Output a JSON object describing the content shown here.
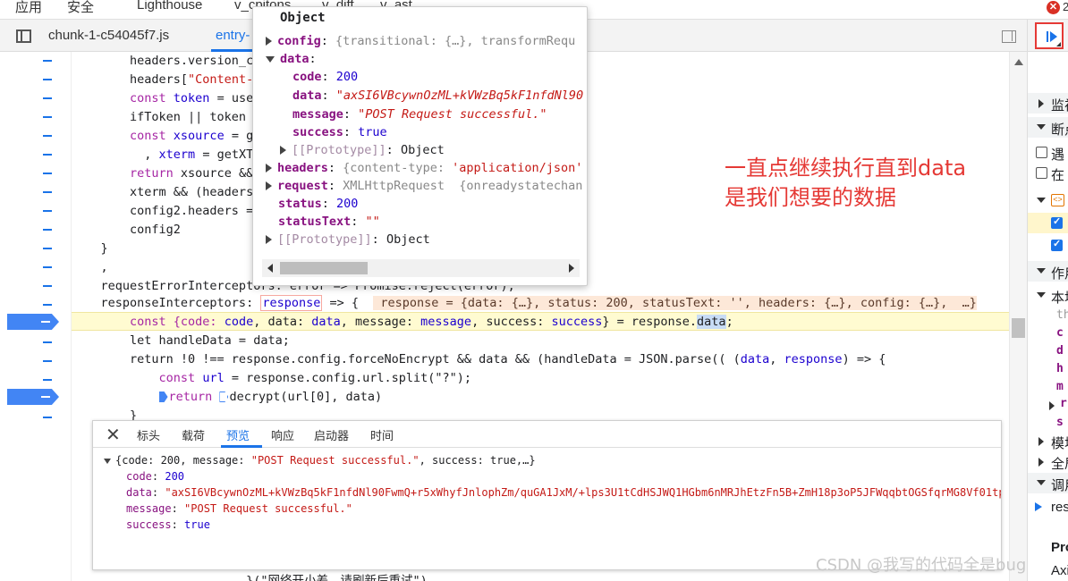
{
  "topbar": {
    "tabs": [
      "应用",
      "安全",
      "Lighthouse",
      "v_cpitons",
      "v_diff",
      "v_ast"
    ],
    "error_badge": "✕",
    "error_extra": "2"
  },
  "file_tabs": {
    "items": [
      "chunk-1-c54045f7.js",
      "entry-"
    ]
  },
  "code": {
    "lines": [
      "        headers.version_c",
      "        headers[\"Content-",
      "        const token = use",
      "        ifToken || token",
      "        const xsource = g",
      "          , xterm = getXT",
      "        return xsource &&",
      "        xterm && (headers",
      "        config2.headers =",
      "        config2",
      "    }",
      "    ,",
      "    requestErrorInterceptors: error => Promise.reject(error),",
      "    responseInterceptors: "
    ],
    "resp_var": "response",
    "arrow": " => {  ",
    "inline_value": " response = {data: {…}, status: 200, statusText: '', headers: {…}, config: {…},  …}",
    "hl_line": {
      "p1": "        const {code: ",
      "code": "code",
      "p2": ", data: ",
      "data": "data",
      "p3": ", message: ",
      "message": "message",
      "p4": ", success: ",
      "success": "success",
      "p5": "} = response.",
      "sel": "data",
      "p6": ";"
    },
    "line_let": "        let handleData = data;",
    "line_return_a": "        return !0 !== response.config.forceNoEncrypt && data && (handleData = JSON.parse(( (",
    "line_return_data": "data",
    "line_return_comma": ", ",
    "line_return_resp": "response",
    "line_return_b": ") => {",
    "line_url_a": "            const ",
    "line_url_v": "url",
    "line_url_b": " = response.config.url.split(\"?\");",
    "line_dec_a": "            ",
    "line_dec_b": "return ",
    "line_dec_c": "decrypt(url[0], data)",
    "line_close": "        }",
    "line_bottom": "                        }(\"网络开小差，请刷新后重试\")"
  },
  "popover": {
    "title": "Object",
    "config_key": "config",
    "config_val": "{transitional: {…}, transformRequ",
    "data_key": "data",
    "code_key": "code",
    "code_val": "200",
    "data_inner_key": "data",
    "data_inner_val": "\"axSI6VBcywnOzML+kVWzBq5kF1nfdNl90",
    "message_key": "message",
    "message_val": "\"POST Request successful.\"",
    "success_key": "success",
    "success_val": "true",
    "proto_inner": "[[Prototype]]",
    "proto_inner_val": "Object",
    "headers_key": "headers",
    "headers_val_a": "{content-type: ",
    "headers_val_b": "'application/json'",
    "request_key": "request",
    "request_val": "XMLHttpRequest  {onreadystatechan",
    "status_key": "status",
    "status_val": "200",
    "statustext_key": "statusText",
    "statustext_val": "\"\"",
    "proto_outer": "[[Prototype]]",
    "proto_outer_val": "Object"
  },
  "annotation": {
    "text": "一直点继续执行直到data\n是我们想要的数据"
  },
  "network": {
    "close": "✕",
    "tabs": [
      "标头",
      "载荷",
      "预览",
      "响应",
      "启动器",
      "时间"
    ],
    "active_tab": "预览",
    "summary_a": "{code: 200, message: ",
    "summary_msg": "\"POST Request successful.\"",
    "summary_b": ", success: true,…}",
    "code_key": "code",
    "code_val": "200",
    "data_key": "data",
    "data_val": "\"axSI6VBcywnOzML+kVWzBq5kF1nfdNl90FwmQ+r5xWhyfJnlophZm/quGA1JxM/+lps3U1tCdHSJWQ1HGbm6nMRJhEtzFn5B+ZmH18p3oP5JFWqqbtOGSfqrMG8Vf01tp",
    "message_key": "message",
    "message_val": "\"POST Request successful.\"",
    "success_key": "success",
    "success_val": "true"
  },
  "right_panel": {
    "watch": "监视",
    "breakpoints": "断点",
    "opt1": "遇",
    "opt2": "在",
    "scope": "作用",
    "local": "本地",
    "vars": [
      "th",
      "c",
      "d",
      "h",
      "m",
      "r",
      "s"
    ],
    "module": "模块",
    "global": "全局",
    "callstack": "调用",
    "res": "res",
    "pro": "Pro",
    "axi": "Axi"
  },
  "watermark": "CSDN @我写的代码全是bug",
  "colors": {
    "accent": "#1a73e8",
    "breakpoint": "#4285f4",
    "annotation_red": "#e53935",
    "highlight_line": "#fffbd1"
  }
}
